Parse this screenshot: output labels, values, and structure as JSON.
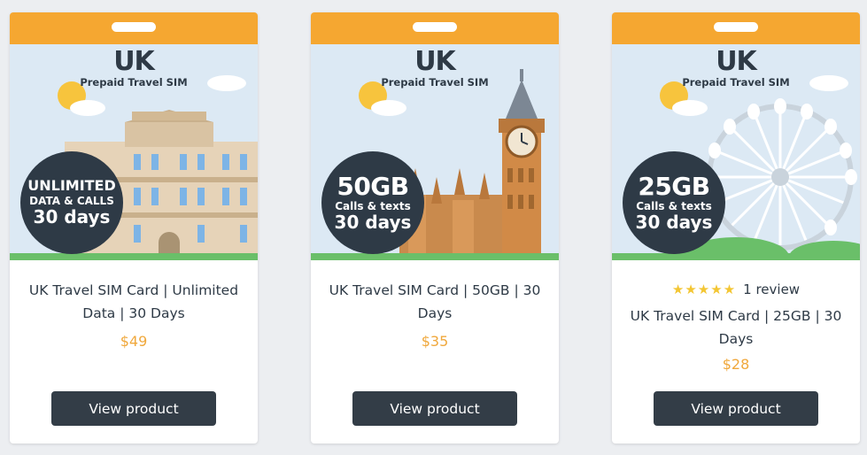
{
  "colors": {
    "background": "#eceef1",
    "sim_orange": "#f5a731",
    "sim_sky": "#dce9f4",
    "badge_dark": "#2e3a46",
    "price_orange": "#f0a83c",
    "star_yellow": "#f3c633",
    "button": "#333d47"
  },
  "products": [
    {
      "sim": {
        "title": "UK",
        "subtitle": "Prepaid Travel SIM",
        "landmark": "buckingham-palace"
      },
      "badge": {
        "line1": "UNLIMITED",
        "line2": "DATA & CALLS",
        "line3": "30 days"
      },
      "name": "UK Travel SIM Card | Unlimited Data | 30 Days",
      "price": "$49",
      "button": "View product"
    },
    {
      "sim": {
        "title": "UK",
        "subtitle": "Prepaid Travel SIM",
        "landmark": "big-ben"
      },
      "badge": {
        "line1": "50GB",
        "line2": "Calls & texts",
        "line3": "30 days"
      },
      "name": "UK Travel SIM Card | 50GB | 30 Days",
      "price": "$35",
      "button": "View product"
    },
    {
      "sim": {
        "title": "UK",
        "subtitle": "Prepaid Travel SIM",
        "landmark": "london-eye"
      },
      "badge": {
        "line1": "25GB",
        "line2": "Calls & texts",
        "line3": "30 days"
      },
      "rating": {
        "stars": "★★★★★",
        "text": "1 review",
        "value": 5
      },
      "name": "UK Travel SIM Card | 25GB | 30 Days",
      "price": "$28",
      "button": "View product"
    }
  ]
}
